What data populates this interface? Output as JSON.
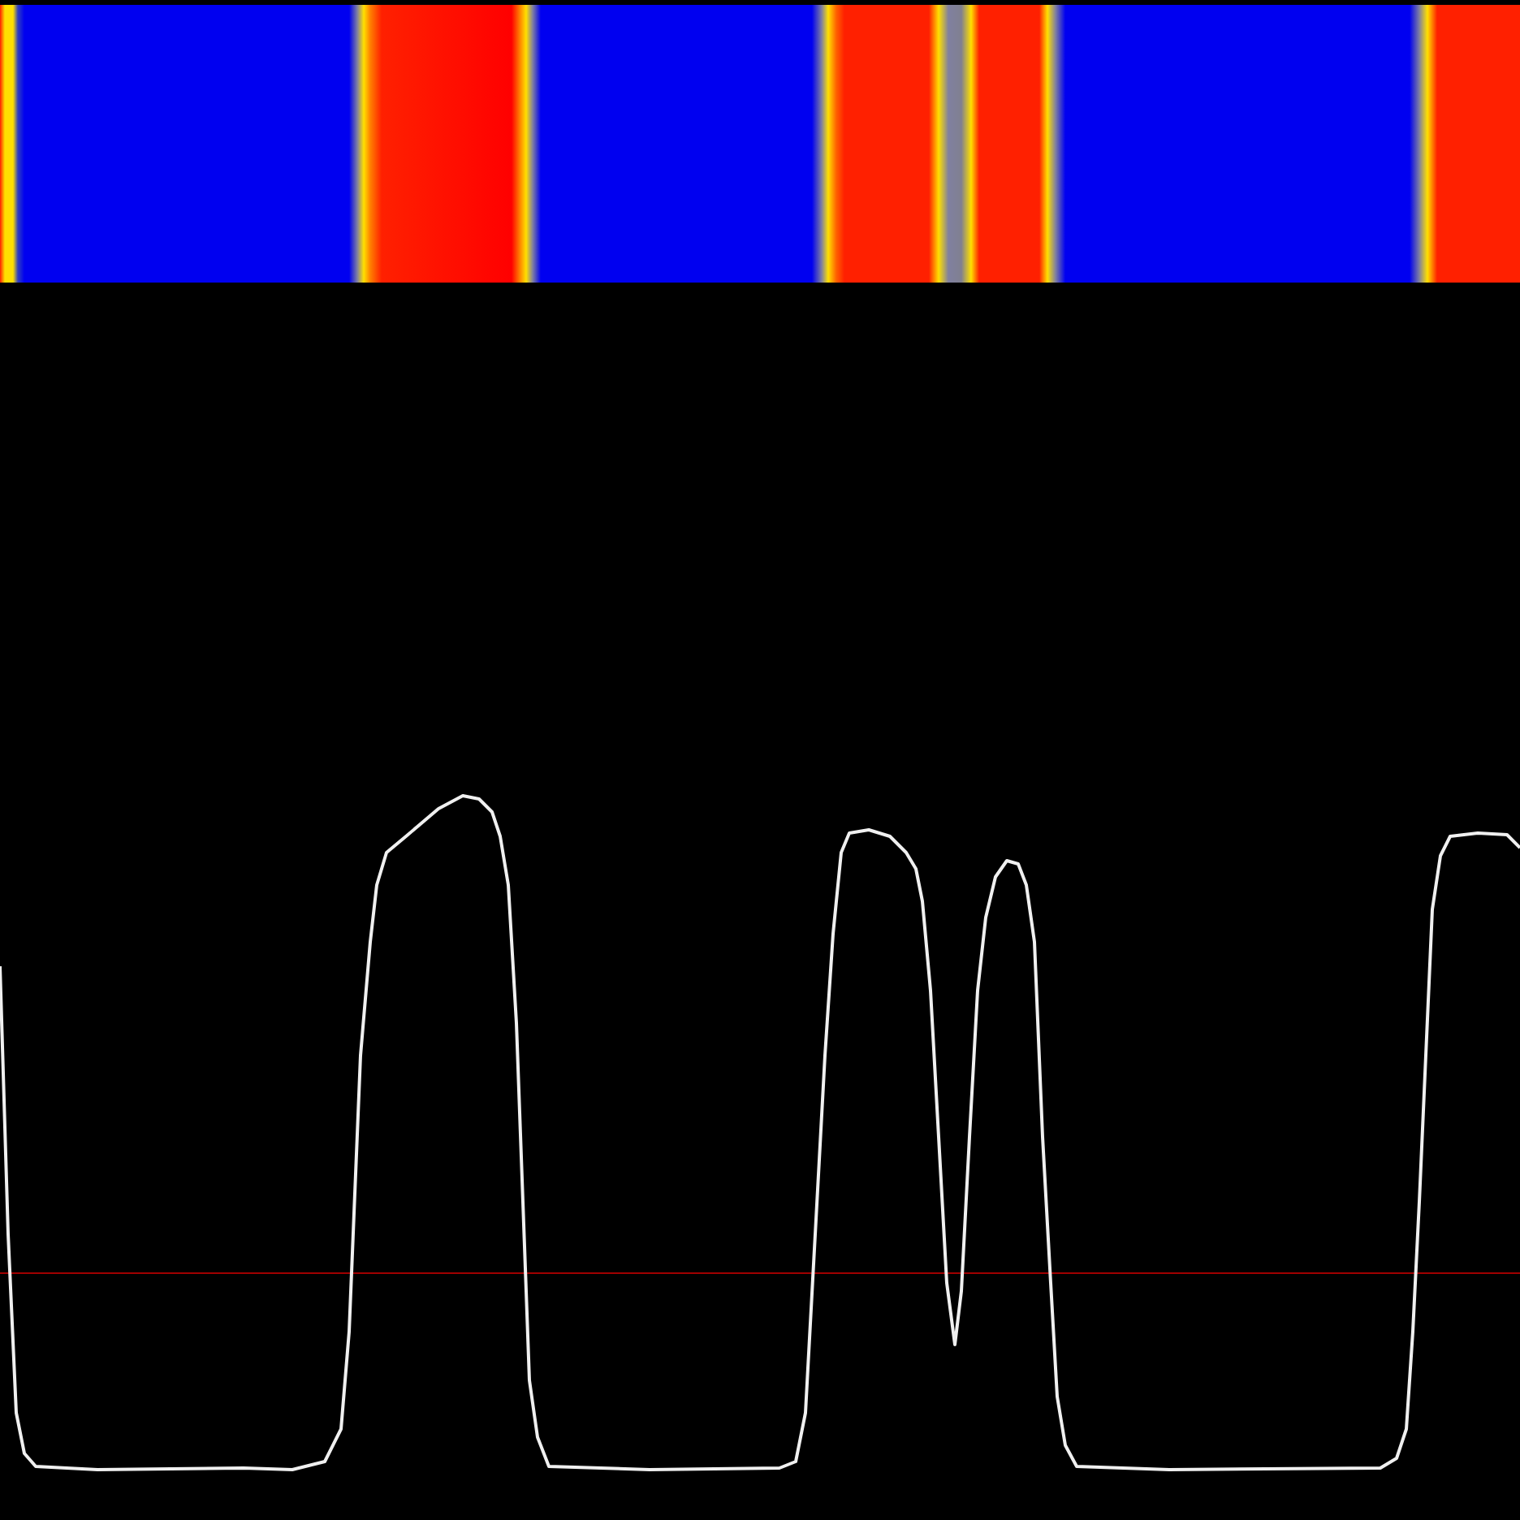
{
  "panels": [
    {
      "kind": "heatmap"
    },
    {
      "kind": "trace"
    }
  ]
}
